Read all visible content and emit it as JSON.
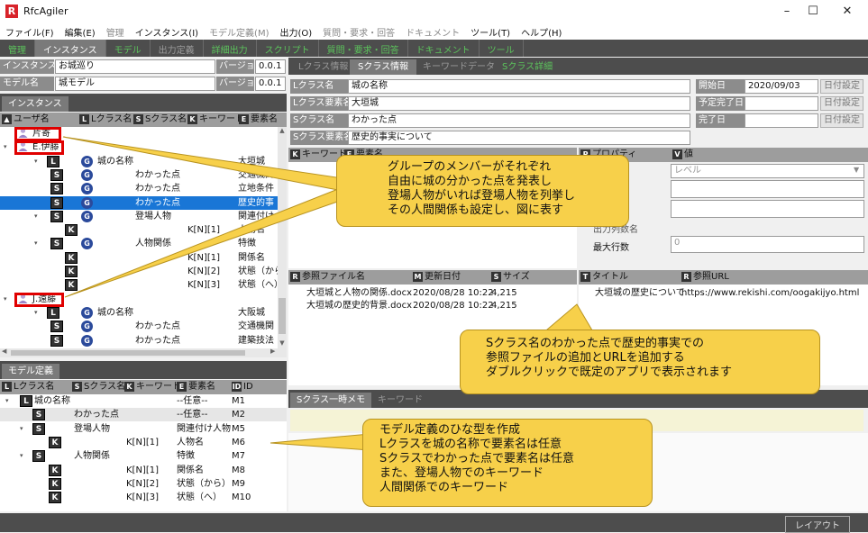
{
  "app": {
    "title": "RfcAgiler",
    "logo": "R"
  },
  "window": {
    "minimize": "–",
    "maximize": "☐",
    "close": "✕"
  },
  "menu": [
    {
      "label": "ファイル(F)",
      "enabled": true
    },
    {
      "label": "編集(E)",
      "enabled": true
    },
    {
      "label": "管理",
      "enabled": false
    },
    {
      "label": "インスタンス(I)",
      "enabled": true
    },
    {
      "label": "モデル定義(M)",
      "enabled": false
    },
    {
      "label": "出力(O)",
      "enabled": true
    },
    {
      "label": "質問・要求・回答",
      "enabled": false
    },
    {
      "label": "ドキュメント",
      "enabled": false
    },
    {
      "label": "ツール(T)",
      "enabled": true
    },
    {
      "label": "ヘルプ(H)",
      "enabled": true
    }
  ],
  "tabs": [
    {
      "label": "管理",
      "state": "green"
    },
    {
      "label": "インスタンス",
      "state": "active"
    },
    {
      "label": "モデル",
      "state": "green"
    },
    {
      "label": "出力定義",
      "state": "dim"
    },
    {
      "label": "詳細出力",
      "state": "green"
    },
    {
      "label": "スクリプト",
      "state": "green"
    },
    {
      "label": "質問・要求・回答",
      "state": "green"
    },
    {
      "label": "ドキュメント",
      "state": "green"
    },
    {
      "label": "ツール",
      "state": "green"
    }
  ],
  "instance": {
    "name_label": "インスタンス名",
    "name_value": "お城巡り",
    "version_label": "バージョン",
    "version_value": "0.0.1",
    "model_label": "モデル名",
    "model_value": "城モデル",
    "model_version_label": "バージョン",
    "model_version_value": "0.0.1"
  },
  "instance_tab": "インスタンス",
  "instance_tree": {
    "columns": [
      {
        "badge": "▲",
        "label": "ユーザ名"
      },
      {
        "badge": "L",
        "label": "Lクラス名"
      },
      {
        "badge": "S",
        "label": "Sクラス名"
      },
      {
        "badge": "K",
        "label": "キーワード"
      },
      {
        "badge": "E",
        "label": "要素名"
      }
    ],
    "rows": [
      {
        "arrow": "",
        "icon": "user",
        "c1": "片寄",
        "c2": "",
        "c3": "",
        "c4": "",
        "c5": ""
      },
      {
        "arrow": "▾",
        "icon": "user",
        "c1": "E.伊藤",
        "c2": "",
        "c3": "",
        "c4": "",
        "c5": ""
      },
      {
        "arrow": "▾",
        "icon": "L",
        "c1": "",
        "c2": "城の名称",
        "c3": "",
        "c4": "",
        "c5": "大垣城"
      },
      {
        "arrow": "",
        "icon": "S",
        "c1": "",
        "c2": "",
        "c3": "わかった点",
        "c4": "",
        "c5": "交通機関"
      },
      {
        "arrow": "",
        "icon": "S",
        "c1": "",
        "c2": "",
        "c3": "わかった点",
        "c4": "",
        "c5": "立地条件"
      },
      {
        "arrow": "",
        "icon": "S",
        "c1": "",
        "c2": "",
        "c3": "わかった点",
        "c4": "",
        "c5": "歴史的事"
      },
      {
        "arrow": "▾",
        "icon": "S",
        "c1": "",
        "c2": "",
        "c3": "登場人物",
        "c4": "",
        "c5": "関連付け人"
      },
      {
        "arrow": "",
        "icon": "K",
        "c1": "",
        "c2": "",
        "c3": "",
        "c4": "K[N][1]",
        "c5": "人物名"
      },
      {
        "arrow": "▾",
        "icon": "S",
        "c1": "",
        "c2": "",
        "c3": "人物関係",
        "c4": "",
        "c5": "特徴"
      },
      {
        "arrow": "",
        "icon": "K",
        "c1": "",
        "c2": "",
        "c3": "",
        "c4": "K[N][1]",
        "c5": "関係名"
      },
      {
        "arrow": "",
        "icon": "K",
        "c1": "",
        "c2": "",
        "c3": "",
        "c4": "K[N][2]",
        "c5": "状態（から"
      },
      {
        "arrow": "",
        "icon": "K",
        "c1": "",
        "c2": "",
        "c3": "",
        "c4": "K[N][3]",
        "c5": "状態（へ）"
      },
      {
        "arrow": "▾",
        "icon": "user",
        "c1": "J.遠藤",
        "c2": "",
        "c3": "",
        "c4": "",
        "c5": ""
      },
      {
        "arrow": "▾",
        "icon": "L",
        "c1": "",
        "c2": "城の名称",
        "c3": "",
        "c4": "",
        "c5": "大阪城"
      },
      {
        "arrow": "",
        "icon": "S",
        "c1": "",
        "c2": "",
        "c3": "わかった点",
        "c4": "",
        "c5": "交通機関"
      },
      {
        "arrow": "",
        "icon": "S",
        "c1": "",
        "c2": "",
        "c3": "わかった点",
        "c4": "",
        "c5": "建築技法"
      }
    ],
    "selected_index": 5
  },
  "model_def_tab": "モデル定義",
  "model_tree": {
    "columns": [
      {
        "badge": "L",
        "label": "Lクラス名"
      },
      {
        "badge": "S",
        "label": "Sクラス名"
      },
      {
        "badge": "K",
        "label": "キーワード"
      },
      {
        "badge": "E",
        "label": "要素名"
      },
      {
        "badge": "ID",
        "label": "ID"
      }
    ],
    "rows": [
      {
        "arrow": "▾",
        "icon": "L",
        "c1": "城の名称",
        "c2": "",
        "c3": "",
        "c4": "--任意--",
        "c5": "M1"
      },
      {
        "arrow": "",
        "icon": "S",
        "c1": "",
        "c2": "わかった点",
        "c3": "",
        "c4": "--任意--",
        "c5": "M2"
      },
      {
        "arrow": "▾",
        "icon": "S",
        "c1": "",
        "c2": "登場人物",
        "c3": "",
        "c4": "関連付け人物",
        "c5": "M5"
      },
      {
        "arrow": "",
        "icon": "K",
        "c1": "",
        "c2": "",
        "c3": "K[N][1]",
        "c4": "人物名",
        "c5": "M6"
      },
      {
        "arrow": "▾",
        "icon": "S",
        "c1": "",
        "c2": "人物関係",
        "c3": "",
        "c4": "特徴",
        "c5": "M7"
      },
      {
        "arrow": "",
        "icon": "K",
        "c1": "",
        "c2": "",
        "c3": "K[N][1]",
        "c4": "関係名",
        "c5": "M8"
      },
      {
        "arrow": "",
        "icon": "K",
        "c1": "",
        "c2": "",
        "c3": "K[N][2]",
        "c4": "状態（から）",
        "c5": "M9"
      },
      {
        "arrow": "",
        "icon": "K",
        "c1": "",
        "c2": "",
        "c3": "K[N][3]",
        "c4": "状態（へ）",
        "c5": "M10"
      }
    ],
    "selected_index": 1
  },
  "right_tabs": [
    {
      "label": "Lクラス情報",
      "state": "dim"
    },
    {
      "label": "Sクラス情報",
      "state": "active"
    },
    {
      "label": "キーワードデータ",
      "state": "dim"
    },
    {
      "label": "Sクラス詳細",
      "state": "green"
    }
  ],
  "sclass_form": {
    "lclass_label": "Lクラス名",
    "lclass_value": "城の名称",
    "lelem_label": "Lクラス要素名",
    "lelem_value": "大垣城",
    "sclass_label": "Sクラス名",
    "sclass_value": "わかった点",
    "selem_label": "Sクラス要素名",
    "selem_value": "歴史的事実について",
    "start_label": "開始日",
    "start_value": "2020/09/03",
    "planned_label": "予定完了日",
    "planned_value": "",
    "done_label": "完了日",
    "done_value": "",
    "date_btn": "日付設定"
  },
  "keyword_header": {
    "k": "キーワード",
    "e": "要素名",
    "p": "プロパティ",
    "v": "値"
  },
  "property_panel": {
    "level_hint": "レベル",
    "max_rows_label": "最大行数",
    "max_rows_value": "0",
    "rows_partial": "出力列数名"
  },
  "file_table": {
    "columns": [
      {
        "badge": "R",
        "label": "参照ファイル名"
      },
      {
        "badge": "M",
        "label": "更新日付"
      },
      {
        "badge": "S",
        "label": "サイズ"
      }
    ],
    "rows": [
      {
        "name": "大垣城と人物の関係.docx",
        "date": "2020/08/28 10:22",
        "size": "4,215"
      },
      {
        "name": "大垣城の歴史的背景.docx",
        "date": "2020/08/28 10:22",
        "size": "4,215"
      }
    ]
  },
  "url_table": {
    "columns": [
      {
        "badge": "T",
        "label": "タイトル"
      },
      {
        "badge": "R",
        "label": "参照URL"
      }
    ],
    "rows": [
      {
        "title": "大垣城の歴史について",
        "url": "https://www.rekishi.com/oogakijyo.html"
      }
    ]
  },
  "memo_tabs": [
    {
      "label": "Sクラス一時メモ",
      "state": "active"
    },
    {
      "label": "キーワード",
      "state": "dim"
    }
  ],
  "callouts": {
    "c1": [
      "グループのメンバーがそれぞれ",
      "自由に城の分かった点を発表し",
      "登場人物がいれば登場人物を列挙し",
      "その人間関係も設定し、図に表す"
    ],
    "c2": [
      "Sクラス名のわかった点で歴史的事実での",
      "参照ファイルの追加とURLを追加する",
      "ダブルクリックで既定のアプリで表示されます"
    ],
    "c3": [
      "モデル定義のひな型を作成",
      "Lクラスを城の名称で要素名は任意",
      "Sクラスでわかった点で要素名は任意",
      "また、登場人物でのキーワード",
      "人間関係でのキーワード"
    ]
  },
  "status": {
    "layout_btn": "レイアウト"
  }
}
